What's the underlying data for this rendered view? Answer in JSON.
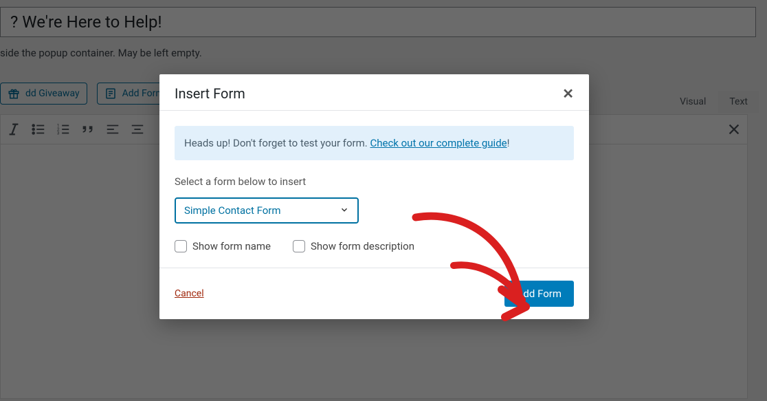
{
  "background": {
    "title_value": "? We're Here to Help!",
    "helper_text": "side the popup container. May be left empty.",
    "add_giveaway_label": "dd Giveaway",
    "add_form_button_label": "Add Form",
    "tabs": {
      "visual": "Visual",
      "text": "Text"
    }
  },
  "modal": {
    "title": "Insert Form",
    "alert_prefix": "Heads up! Don't forget to test your form. ",
    "alert_link": "Check out our complete guide",
    "alert_suffix": "!",
    "select_label": "Select a form below to insert",
    "selected_form": "Simple Contact Form",
    "checkbox_name_label": "Show form name",
    "checkbox_desc_label": "Show form description",
    "cancel_label": "Cancel",
    "submit_label": "Add Form"
  },
  "colors": {
    "accent": "#007cba",
    "link": "#0073aa",
    "alert_bg": "#e2f0fb",
    "danger": "#a0280d",
    "annotation": "#da2020"
  }
}
